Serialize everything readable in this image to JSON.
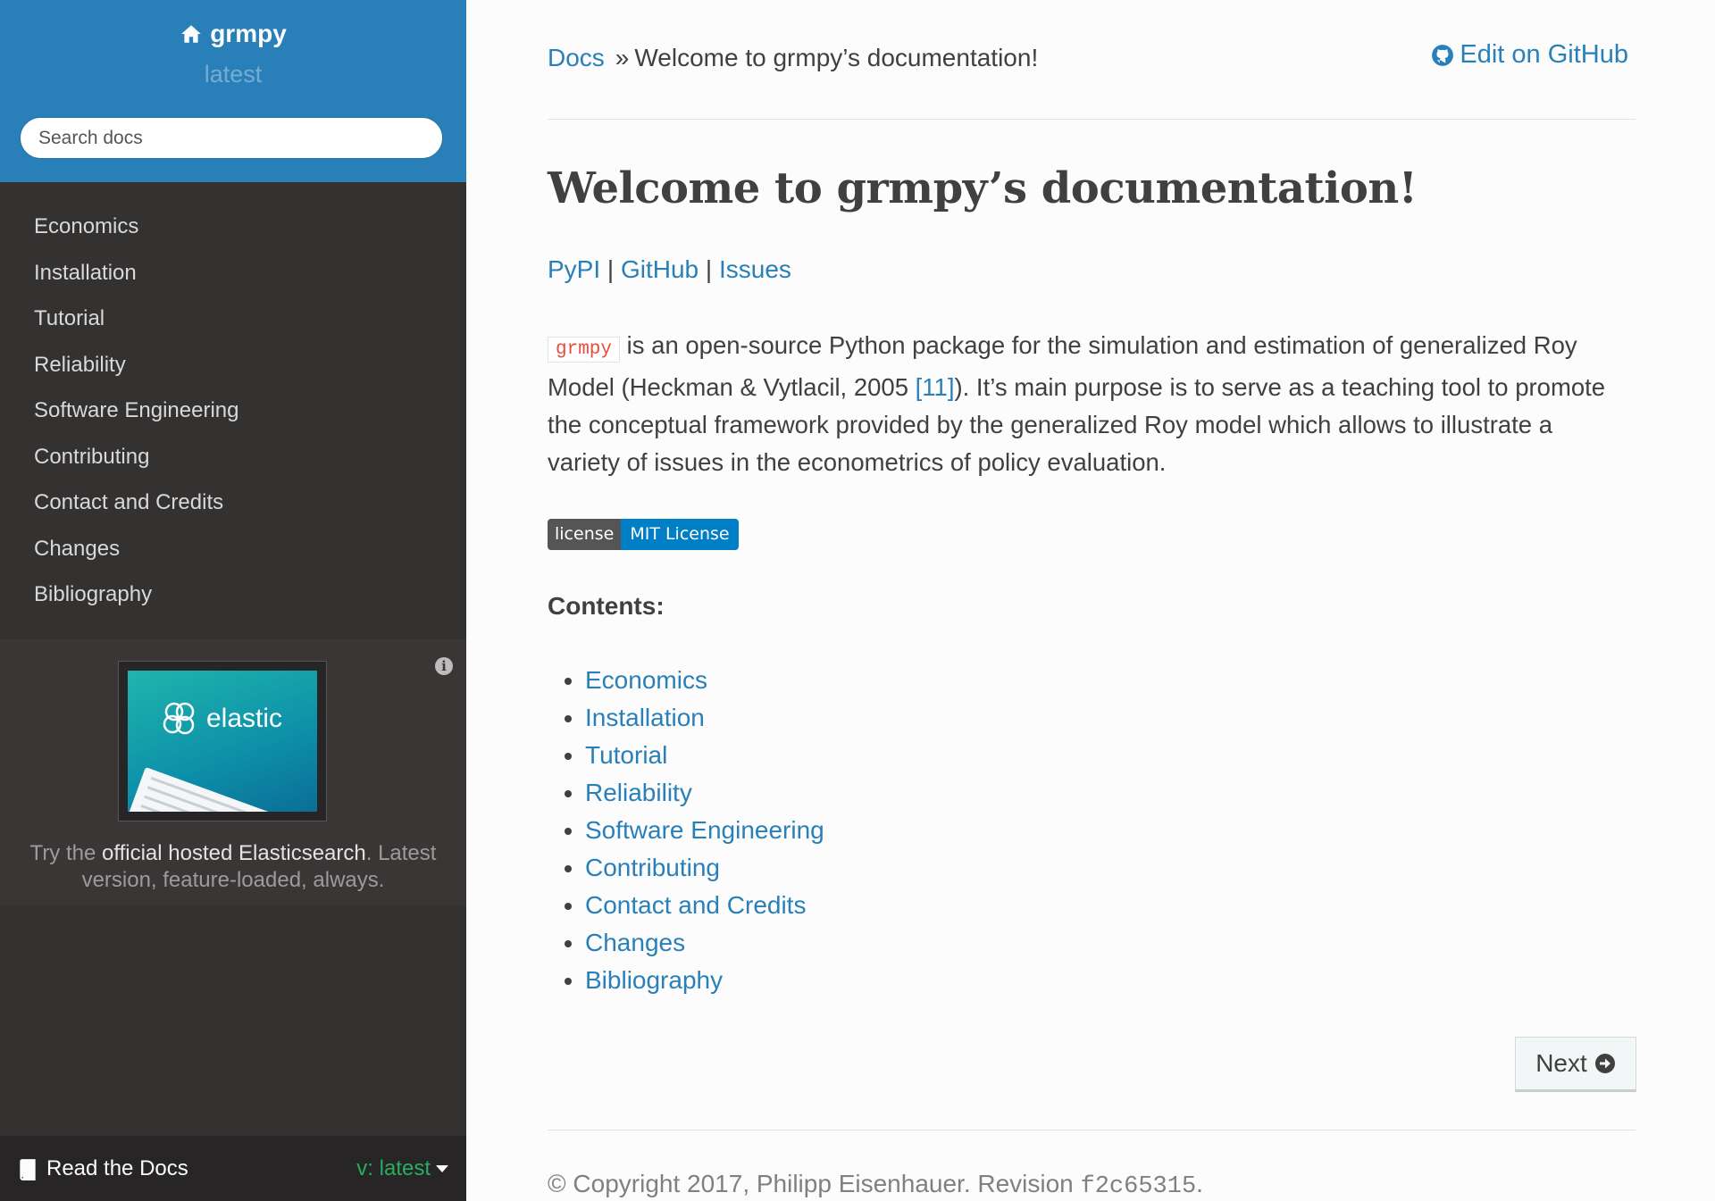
{
  "sidebar": {
    "project": "grmpy",
    "version": "latest",
    "search_placeholder": "Search docs",
    "items": [
      {
        "label": "Economics"
      },
      {
        "label": "Installation"
      },
      {
        "label": "Tutorial"
      },
      {
        "label": "Reliability"
      },
      {
        "label": "Software Engineering"
      },
      {
        "label": "Contributing"
      },
      {
        "label": "Contact and Credits"
      },
      {
        "label": "Changes"
      },
      {
        "label": "Bibliography"
      }
    ],
    "ad": {
      "logo_text": "elastic",
      "text_pre": "Try the ",
      "link_text": "official hosted Elasticsearch",
      "text_post": ". Latest version, feature-loaded, always."
    },
    "footer": {
      "rtd_label": "Read the Docs",
      "version_label": "v: latest"
    }
  },
  "main": {
    "breadcrumb": {
      "root": "Docs",
      "separator": "»",
      "current": "Welcome to grmpy’s documentation!"
    },
    "edit_label": "Edit on GitHub",
    "title": "Welcome to grmpy’s documentation!",
    "links": [
      "PyPI",
      "GitHub",
      "Issues"
    ],
    "link_separator": "|",
    "paragraph": {
      "code": "grmpy",
      "text1": " is an open-source Python package for the simulation and estimation of generalized Roy Model (Heckman & Vytlacil, 2005 ",
      "citation": "[11]",
      "text2": "). It’s main purpose is to serve as a teaching tool to promote the conceptual framework provided by the generalized Roy model which allows to illustrate a variety of issues in the econometrics of policy evaluation."
    },
    "badge": {
      "left": "license",
      "right": "MIT License"
    },
    "contents_title": "Contents:",
    "toc": [
      "Economics",
      "Installation",
      "Tutorial",
      "Reliability",
      "Software Engineering",
      "Contributing",
      "Contact and Credits",
      "Changes",
      "Bibliography"
    ],
    "next_label": "Next",
    "copyright_text": "© Copyright 2017, Philipp Eisenhauer. Revision ",
    "revision": "f2c65315",
    "copyright_end": "."
  },
  "colors": {
    "accent": "#2980b9",
    "sidebar_bg": "#343131",
    "badge_blue": "#007ec6",
    "code_red": "#e74c3c",
    "version_green": "#27ae60"
  }
}
